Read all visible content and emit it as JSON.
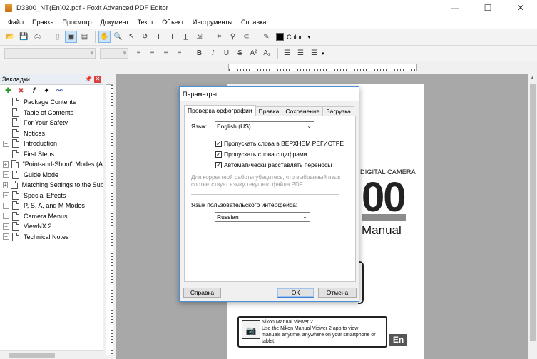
{
  "window": {
    "title": "D3300_NT(En)02.pdf - Foxit Advanced PDF Editor",
    "minimize": "—",
    "maximize": "☐",
    "close": "✕"
  },
  "menu": [
    "Файл",
    "Правка",
    "Просмотр",
    "Документ",
    "Текст",
    "Объект",
    "Инструменты",
    "Справка"
  ],
  "toolbar": {
    "color_label": "Color"
  },
  "bookmarks": {
    "title": "Закладки",
    "items": [
      {
        "label": "Package Contents",
        "expandable": false
      },
      {
        "label": "Table of Contents",
        "expandable": false
      },
      {
        "label": "For Your Safety",
        "expandable": false
      },
      {
        "label": "Notices",
        "expandable": false
      },
      {
        "label": "Introduction",
        "expandable": true
      },
      {
        "label": "First Steps",
        "expandable": false
      },
      {
        "label": "\"Point-and-Shoot\" Modes (A",
        "expandable": true
      },
      {
        "label": "Guide Mode",
        "expandable": true
      },
      {
        "label": "Matching Settings to the Sub",
        "expandable": true
      },
      {
        "label": "Special Effects",
        "expandable": true
      },
      {
        "label": "P, S, A, and M Modes",
        "expandable": true
      },
      {
        "label": "Camera Menus",
        "expandable": true
      },
      {
        "label": "ViewNX 2",
        "expandable": true
      },
      {
        "label": "Technical Notes",
        "expandable": true
      }
    ]
  },
  "document": {
    "camera_text": "DIGITAL CAMERA",
    "big_number": "00",
    "manual_text": "Manual",
    "viewer_title": "Nikon Manual Viewer 2",
    "viewer_line1": "Use the Nikon Manual Viewer 2 app to view",
    "viewer_line2": "manuals anytime, anywhere on your smartphone or",
    "viewer_line3": "tablet.",
    "lang_badge": "En"
  },
  "dialog": {
    "title": "Параметры",
    "tabs": [
      "Проверка орфографии",
      "Правка",
      "Сохранение",
      "Загрузка"
    ],
    "language_label": "Язык:",
    "language_value": "English (US)",
    "checkboxes": [
      {
        "label": "Пропускать слова в ВЕРХНЕМ РЕГИСТРЕ",
        "checked": true
      },
      {
        "label": "Пропускать слова с цифрами",
        "checked": true
      },
      {
        "label": "Автоматически расставлять переносы",
        "checked": true
      }
    ],
    "hint": "Для корректной работы убедитесь, что выбранный язык соответствует языку текущего файла PDF.",
    "ui_language_label": "Язык пользовательского интерфейса:",
    "ui_language_value": "Russian",
    "help_button": "Справка",
    "ok_button": "ОК",
    "cancel_button": "Отмена"
  }
}
